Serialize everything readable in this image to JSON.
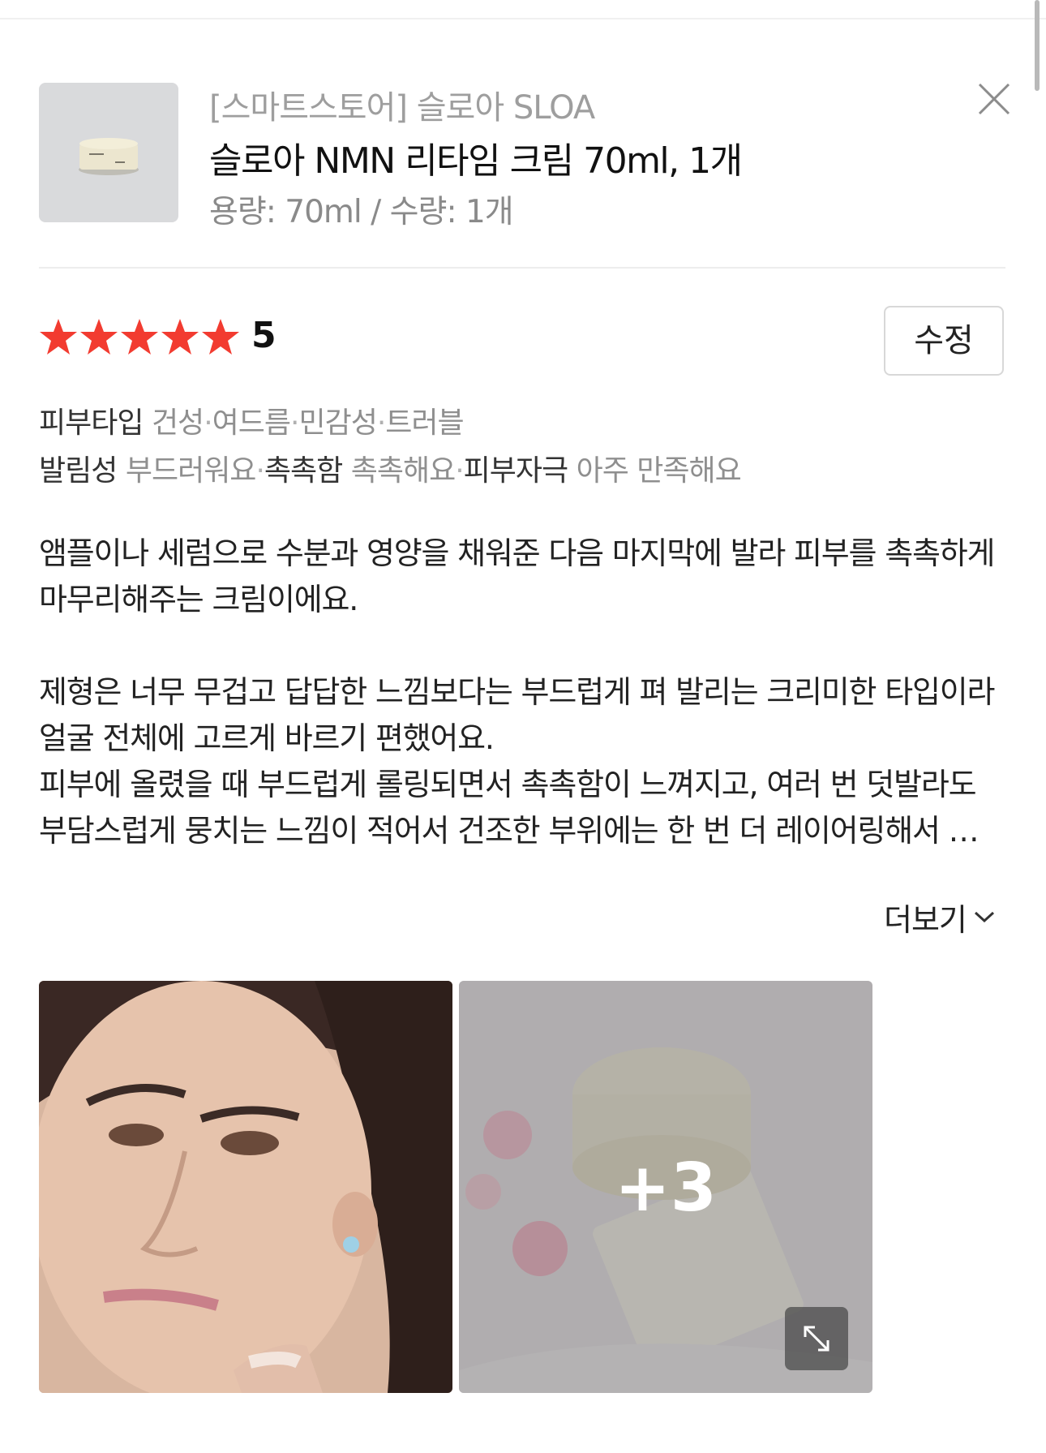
{
  "product": {
    "store": "[스마트스토어] 슬로아 SLOA",
    "name": "슬로아 NMN 리타임 크림 70ml, 1개",
    "option": "용량: 70ml / 수량: 1개"
  },
  "rating": {
    "value": "5",
    "stars_filled": 5,
    "stars_total": 5,
    "star_color": "#f23b30"
  },
  "edit_button_label": "수정",
  "attributes": {
    "skin_type": {
      "label": "피부타입",
      "values": [
        "건성",
        "여드름",
        "민감성",
        "트러블"
      ]
    },
    "spreadability": {
      "label": "발림성",
      "value": "부드러워요"
    },
    "moisture": {
      "label": "촉촉함",
      "value": "촉촉해요"
    },
    "irritation": {
      "label": "피부자극",
      "value": "아주 만족해요"
    },
    "separator": "·"
  },
  "review": {
    "paragraph_1": "앰플이나 세럼으로 수분과 영양을 채워준 다음 마지막에 발라 피부를 촉촉하게 마무리해주는 크림이에요.",
    "paragraph_2": "제형은 너무 무겁고 답답한 느낌보다는 부드럽게 펴 발리는 크리미한 타입이라 얼굴 전체에 고르게 바르기 편했어요.",
    "paragraph_3": "피부에 올렸을 때 부드럽게 롤링되면서 촉촉함이 느껴지고, 여러 번 덧발라도 부담스럽게 뭉치는 느낌이 적어서 건조한 부위에는 한 번 더 레이어링해서 …"
  },
  "more_label": "더보기",
  "photos": {
    "extra_count": "+3",
    "icons": [
      "close-icon",
      "star-icon",
      "chevron-down-icon",
      "expand-icon"
    ]
  }
}
